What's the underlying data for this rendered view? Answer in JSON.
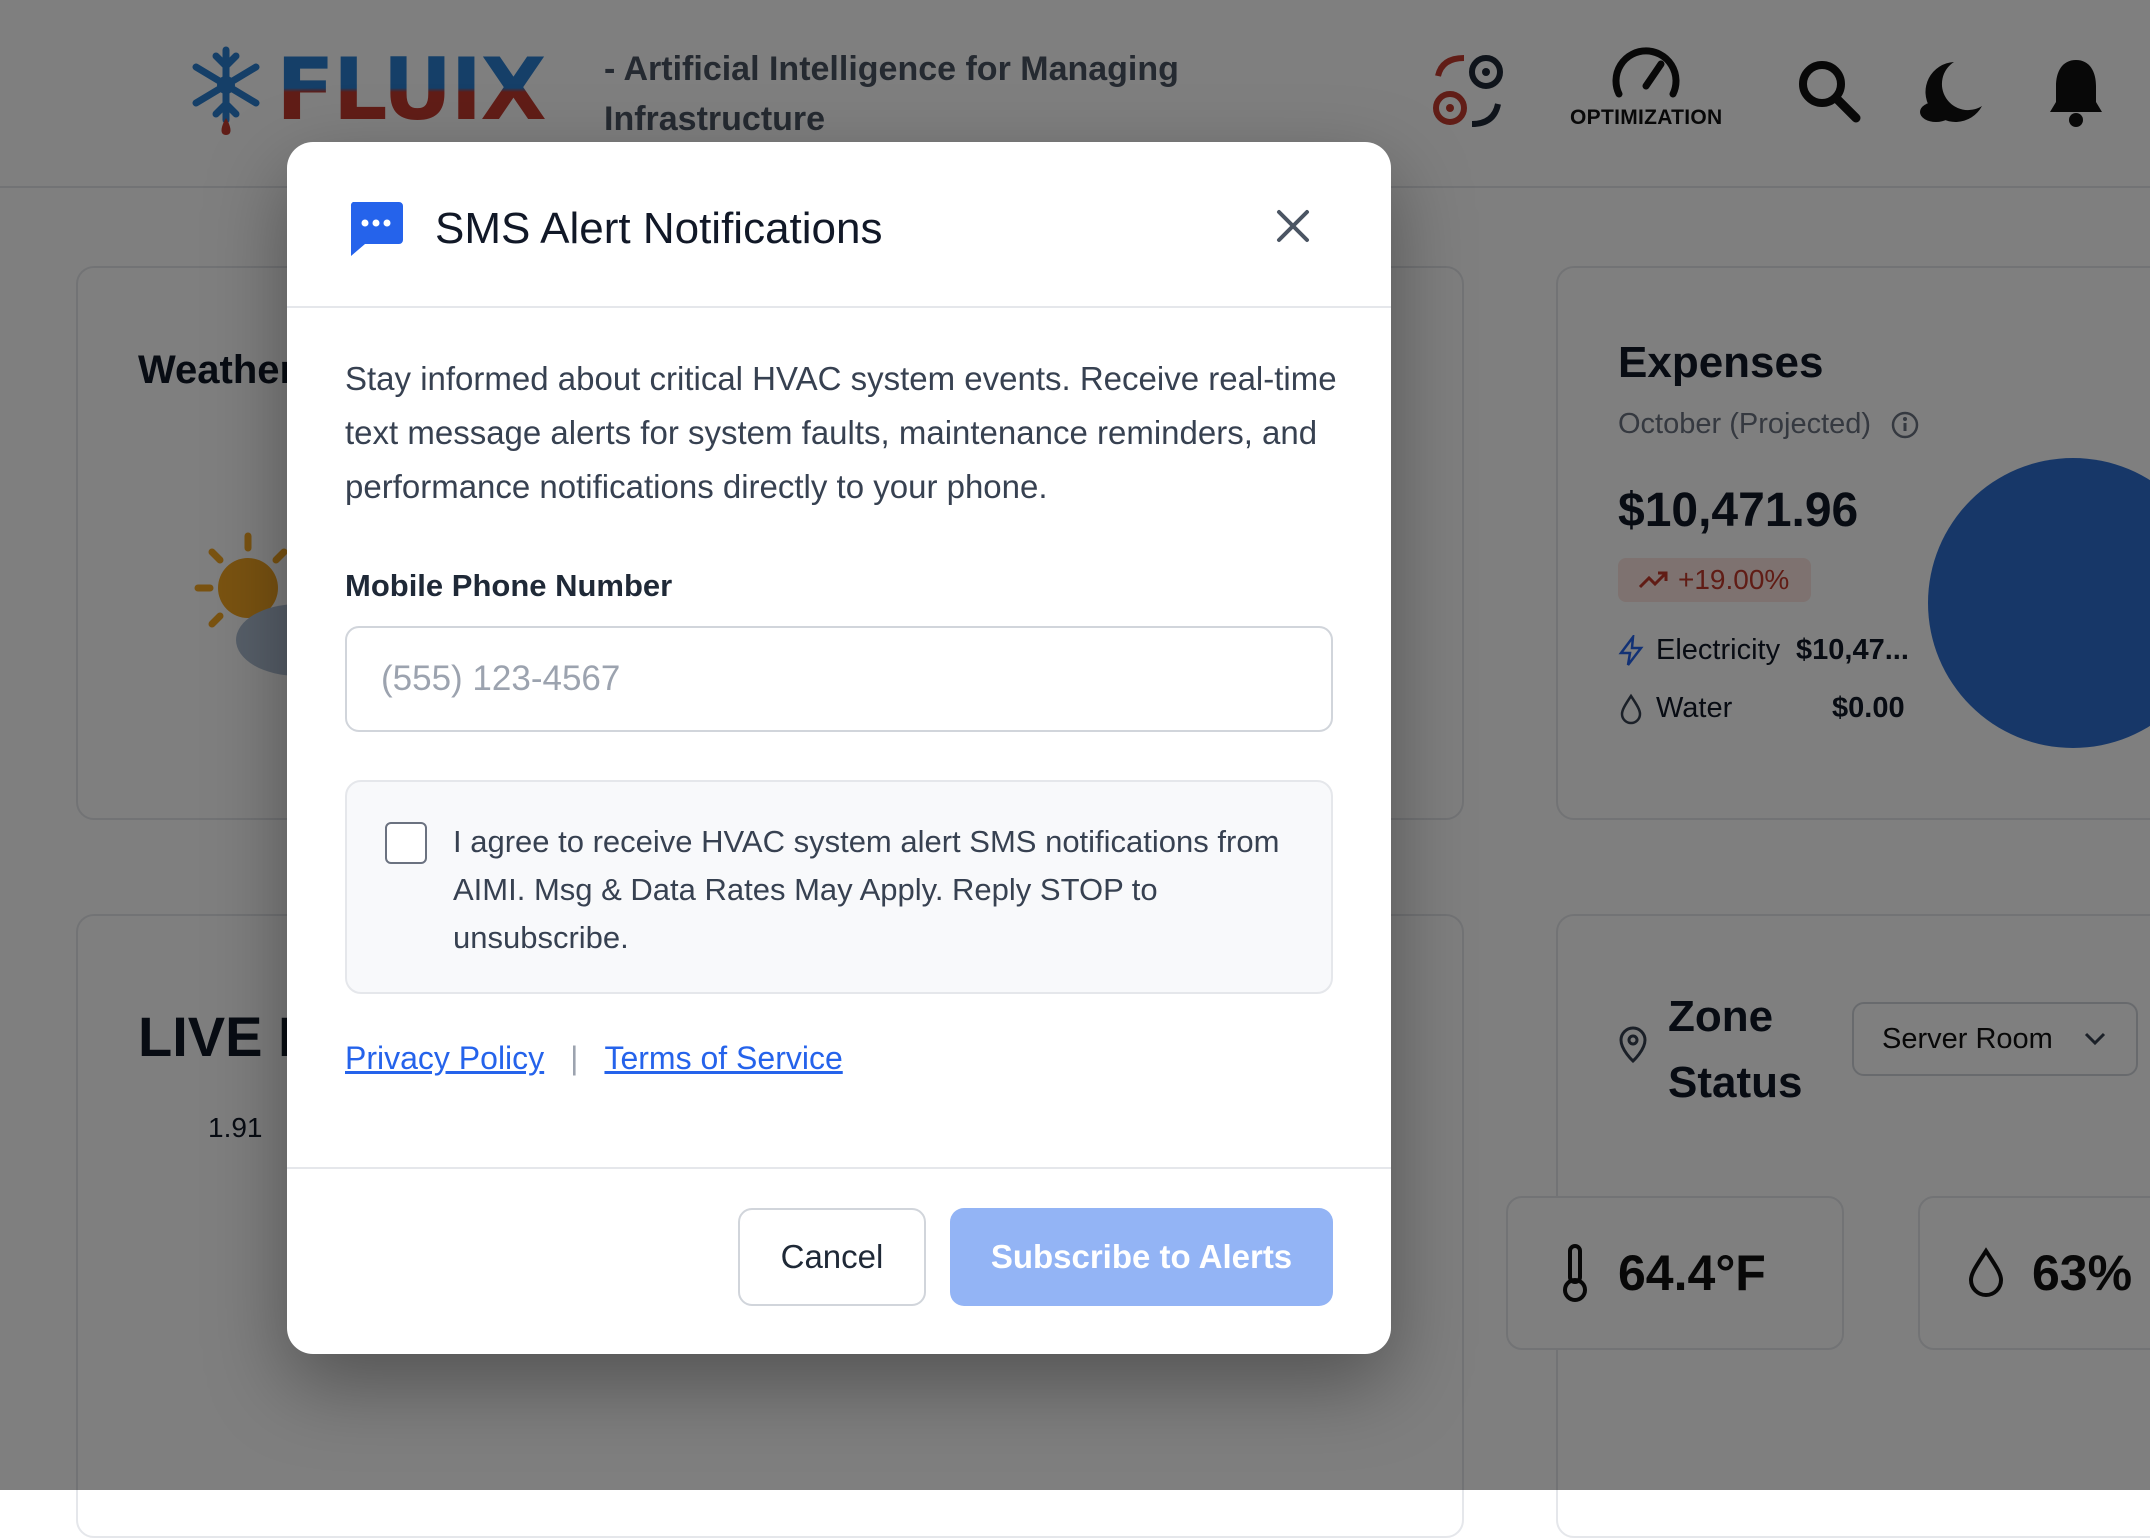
{
  "header": {
    "logo_text": "FLUIX",
    "tagline": "- Artificial Intelligence for Managing Infrastructure",
    "optimization_label": "OPTIMIZATION"
  },
  "weather": {
    "title": "Weather"
  },
  "live": {
    "title": "LIVE P",
    "value": "1.91"
  },
  "expenses": {
    "title": "Expenses",
    "period": "October (Projected)",
    "amount": "$10,471.96",
    "change": "+19.00%",
    "electricity_label": "Electricity",
    "electricity_value": "$10,47...",
    "water_label": "Water",
    "water_value": "$0.00"
  },
  "zone": {
    "title_line1": "Zone",
    "title_line2": "Status",
    "selected": "Server Room",
    "temperature": "64.4°F",
    "humidity": "63%"
  },
  "modal": {
    "title": "SMS Alert Notifications",
    "description": "Stay informed about critical HVAC system events. Receive real-time text message alerts for system faults, maintenance reminders, and performance notifications directly to your phone.",
    "phone_label": "Mobile Phone Number",
    "phone_placeholder": "(555) 123-4567",
    "phone_value": "",
    "consent_text": "I agree to receive HVAC system alert SMS notifications from AIMI. Msg & Data Rates May Apply. Reply STOP to unsubscribe.",
    "privacy_link": "Privacy Policy",
    "separator": "|",
    "terms_link": "Terms of Service",
    "cancel_label": "Cancel",
    "subscribe_label": "Subscribe to Alerts"
  },
  "colors": {
    "accent": "#2563eb",
    "subscribe_disabled": "#93b4f5",
    "badge_bg": "#fde4e0",
    "badge_text": "#c0392b"
  }
}
